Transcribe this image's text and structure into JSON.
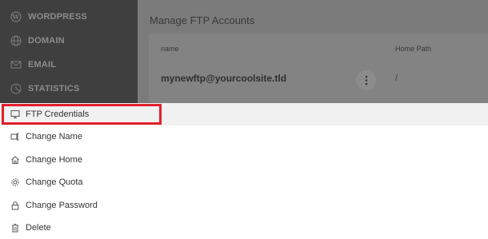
{
  "sidebar": {
    "items": [
      {
        "label": "WORDPRESS",
        "icon": "wordpress-icon"
      },
      {
        "label": "DOMAIN",
        "icon": "globe-icon"
      },
      {
        "label": "EMAIL",
        "icon": "envelope-icon"
      },
      {
        "label": "STATISTICS",
        "icon": "pie-chart-icon"
      }
    ]
  },
  "main": {
    "title": "Manage FTP Accounts",
    "table": {
      "columns": [
        "name",
        "Home Path"
      ],
      "rows": [
        {
          "name": "mynewftp@yourcoolsite.tld",
          "home": "/"
        }
      ]
    }
  },
  "menu": {
    "items": [
      {
        "label": "FTP Credentials",
        "icon": "monitor-icon"
      },
      {
        "label": "Change Name",
        "icon": "edit-tag-icon"
      },
      {
        "label": "Change Home",
        "icon": "home-icon"
      },
      {
        "label": "Change Quota",
        "icon": "gear-icon"
      },
      {
        "label": "Change Password",
        "icon": "lock-icon"
      },
      {
        "label": "Delete",
        "icon": "trash-icon"
      }
    ]
  },
  "colors": {
    "highlight": "#e0202a",
    "sidebar_bg": "#3f3f3f",
    "overlay_bg": "#7a7a7a"
  }
}
